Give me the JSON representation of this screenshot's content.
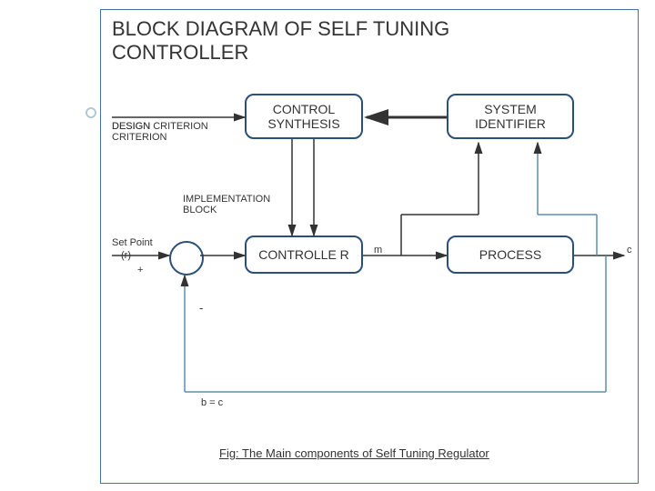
{
  "title": "BLOCK DIAGRAM OF SELF TUNING CONTROLLER",
  "blocks": {
    "control_synthesis": "CONTROL SYNTHESIS",
    "system_identifier": "SYSTEM IDENTIFIER",
    "controller": "CONTROLLE R",
    "process": "PROCESS"
  },
  "labels": {
    "design_criterion": "DESIGN CRITERION",
    "implementation_block": "IMPLEMENTATION BLOCK",
    "set_point": "Set Point",
    "r": "(r)",
    "plus": "+",
    "minus": "-",
    "m": "m",
    "c": "c",
    "feedback": "b = c"
  },
  "caption": "Fig: The Main components of Self Tuning Regulator"
}
